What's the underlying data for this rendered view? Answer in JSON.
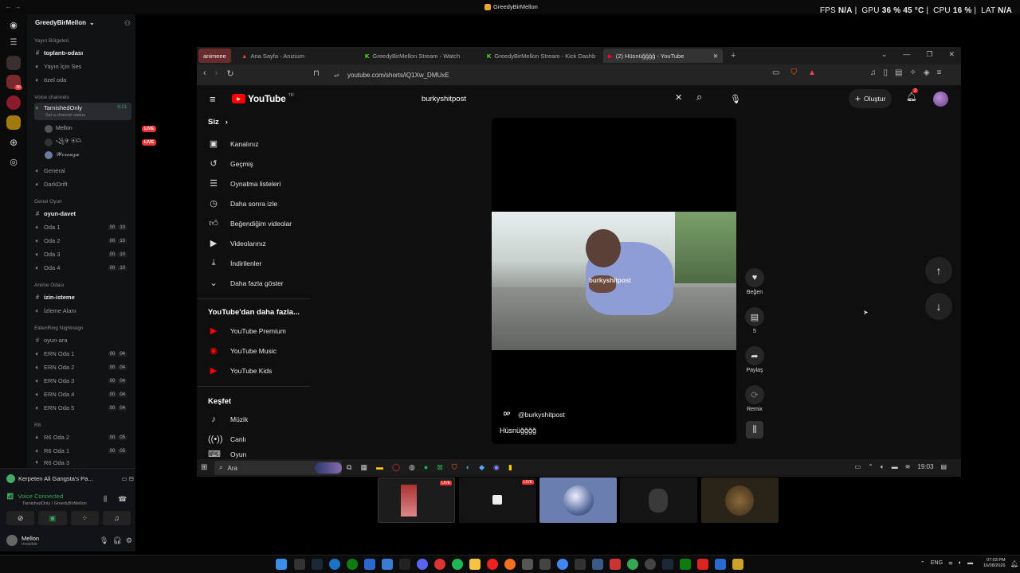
{
  "system": {
    "window_title": "GreedyBirMellon",
    "overlay": {
      "fps_label": "FPS",
      "fps_value": "N/A",
      "gpu_label": "GPU",
      "gpu_value": "36 % 45 °C",
      "cpu_label": "CPU",
      "cpu_value": "16 %",
      "lat_label": "LAT",
      "lat_value": "N/A"
    }
  },
  "discord": {
    "server_name": "GreedyBirMellon",
    "server_badge": "36",
    "categories": {
      "yayin": "Yayın Bölgeleri",
      "voice": "Voice channels",
      "genel": "Genel Oyun",
      "anime": "Anime Odası",
      "elden": "EldenRing Nightreign",
      "r6": "R6"
    },
    "channels": {
      "toplanti": "toplantı-odası",
      "yayin_ses": "Yayın İçin Ses",
      "ozel": "özel oda",
      "tarnished": "TarnishedOnly",
      "tarnished_time": "6:21",
      "status": "Set a channel status",
      "general": "General",
      "darkdrift": "DarkDrift",
      "oyun_davet": "oyun-davet",
      "oda1": "Oda 1",
      "oda2": "Oda 2",
      "oda3": "Oda 3",
      "oda4": "Oda 4",
      "izin": "izin-isteme",
      "izleme": "İzleme Alanı",
      "oyun_ara": "oyun-ara",
      "ern1": "ERN Oda 1",
      "ern2": "ERN Oda 2",
      "ern3": "ERN Oda 3",
      "ern4": "ERN Oda 4",
      "ern5": "ERN Oda 5",
      "r6_2": "R6 Oda 2",
      "r6_1": "R6 Oda 1",
      "r6_3": "R6 Oda 3"
    },
    "counts": {
      "c00": "00",
      "c10": "10",
      "c04": "04",
      "c05": "05"
    },
    "users": {
      "u1": "Mellon",
      "u2": "꧁✞ ⦿ᗩ",
      "u3": "𝓦𝓸𝓻𝓮𝓷𝔃𝓪",
      "live": "LIVE"
    },
    "activity": "Kerpeten Ali Gangsta's Pa...",
    "voice_connected": "Voice Connected",
    "voice_sub": "TarnishedOnly / GreedyBirMellon",
    "me_name": "Mellon",
    "me_status": "Invisible"
  },
  "browser": {
    "tabs": [
      "animeee",
      "Ana Sayfa - Anizium",
      "GreedyBirMellon Stream - Watch",
      "GreedyBirMellon Stream - Kick Dashb",
      "(2) Hüsnüğğğğ - YouTube"
    ],
    "url": "youtube.com/shorts/iQ1Xw_DMUxE"
  },
  "youtube": {
    "logo": "YouTube",
    "logo_sup": "TR",
    "search_value": "burkyshitpost",
    "create_label": "Oluştur",
    "notif_count": "2",
    "sidebar": {
      "you": "Siz",
      "items": [
        "Kanalınız",
        "Geçmiş",
        "Oynatma listeleri",
        "Daha sonra izle",
        "Beğendiğim videolar",
        "Videolarınız",
        "İndirilenler",
        "Daha fazla göster"
      ],
      "more_header": "YouTube'dan daha fazla...",
      "more": [
        "YouTube Premium",
        "YouTube Music",
        "YouTube Kids"
      ],
      "explore_header": "Keşfet",
      "explore": [
        "Müzik",
        "Canlı",
        "Oyun"
      ]
    },
    "short": {
      "watermark": "burkyshitpost",
      "channel": "@burkyshitpost",
      "title": "Hüsnüğğğğ"
    },
    "actions": {
      "like": "Beğen",
      "comments": "5",
      "share": "Paylaş",
      "remix": "Remix"
    }
  },
  "inner_taskbar": {
    "search": "Ara",
    "time": "19:03"
  },
  "taskbar": {
    "lang": "ENG",
    "time": "07:03 PM",
    "date": "16/08/2026"
  }
}
